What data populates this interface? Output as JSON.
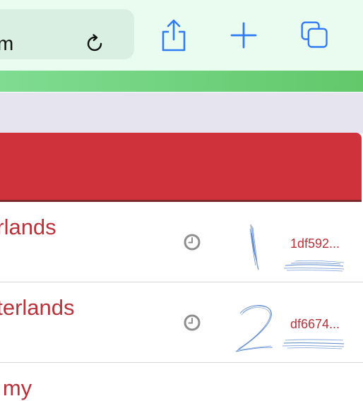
{
  "browser": {
    "url_text": "om",
    "progress": 1.0
  },
  "rows": [
    {
      "title": "erlands",
      "hash": "1df592...",
      "icon": "clock-icon"
    },
    {
      "title": "nterlands",
      "hash": "df6674...",
      "icon": "clock-icon"
    },
    {
      "title": "u my"
    }
  ],
  "colors": {
    "accent_red": "#cf323b",
    "link_red": "#b93139",
    "ios_blue": "#2f7bf6",
    "progress_green": "#62c86a"
  }
}
